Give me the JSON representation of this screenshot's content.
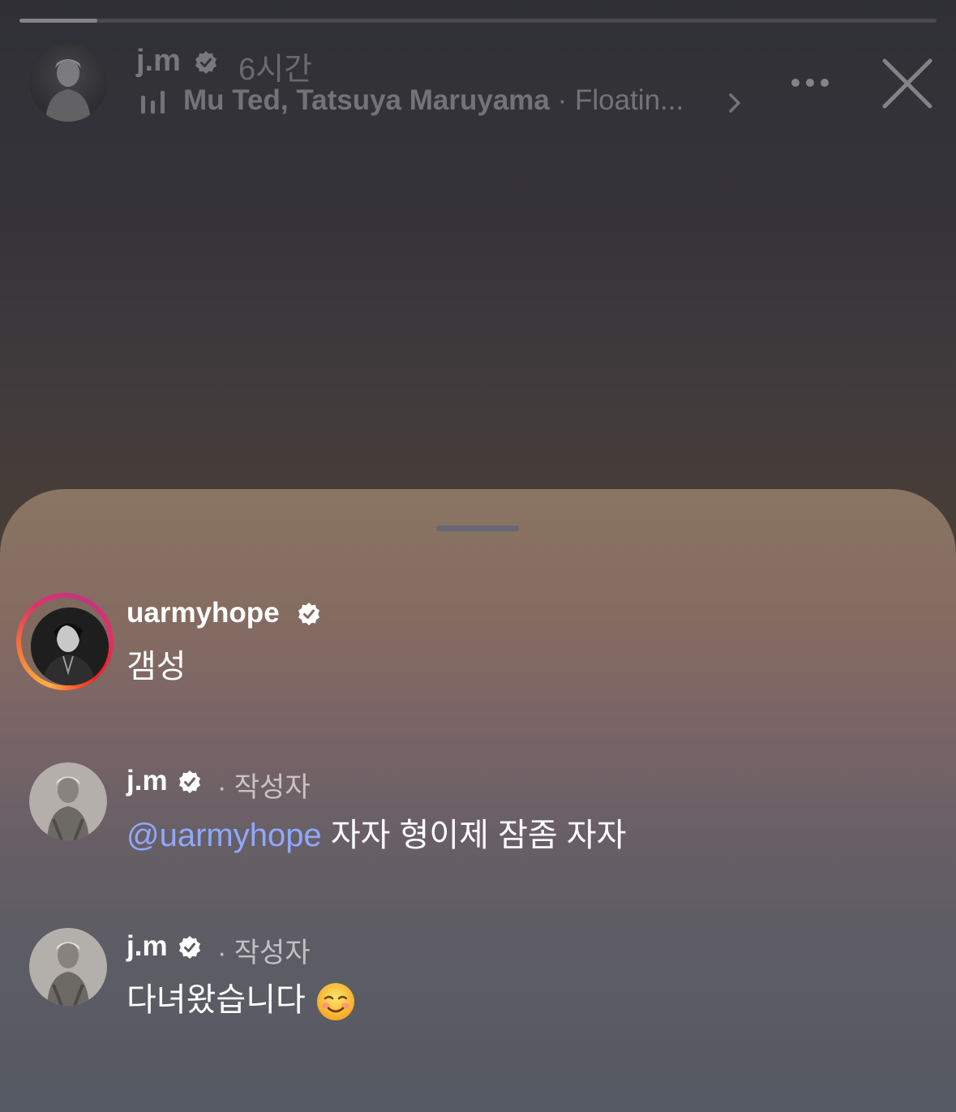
{
  "story": {
    "progress": 0.085,
    "username": "j.m",
    "verified": true,
    "time_ago": "6시간",
    "music": {
      "artist": "Mu Ted, Tatsuya Maruyama",
      "separator": " · ",
      "track": "Floatin..."
    }
  },
  "comments": [
    {
      "username": "uarmyhope",
      "verified": true,
      "has_story_ring": true,
      "text": "갬성"
    },
    {
      "username": "j.m",
      "verified": true,
      "author_label": "· 작성자",
      "mention": "@uarmyhope",
      "text": " 자자 형이제 잠좀 자자"
    },
    {
      "username": "j.m",
      "verified": true,
      "author_label": "· 작성자",
      "text": "다녀왔습니다",
      "emoji": "smiling-face-icon"
    }
  ],
  "colors": {
    "mention": "#8ea8ff",
    "ring_start": "#fcaf45",
    "ring_end": "#c13584"
  }
}
